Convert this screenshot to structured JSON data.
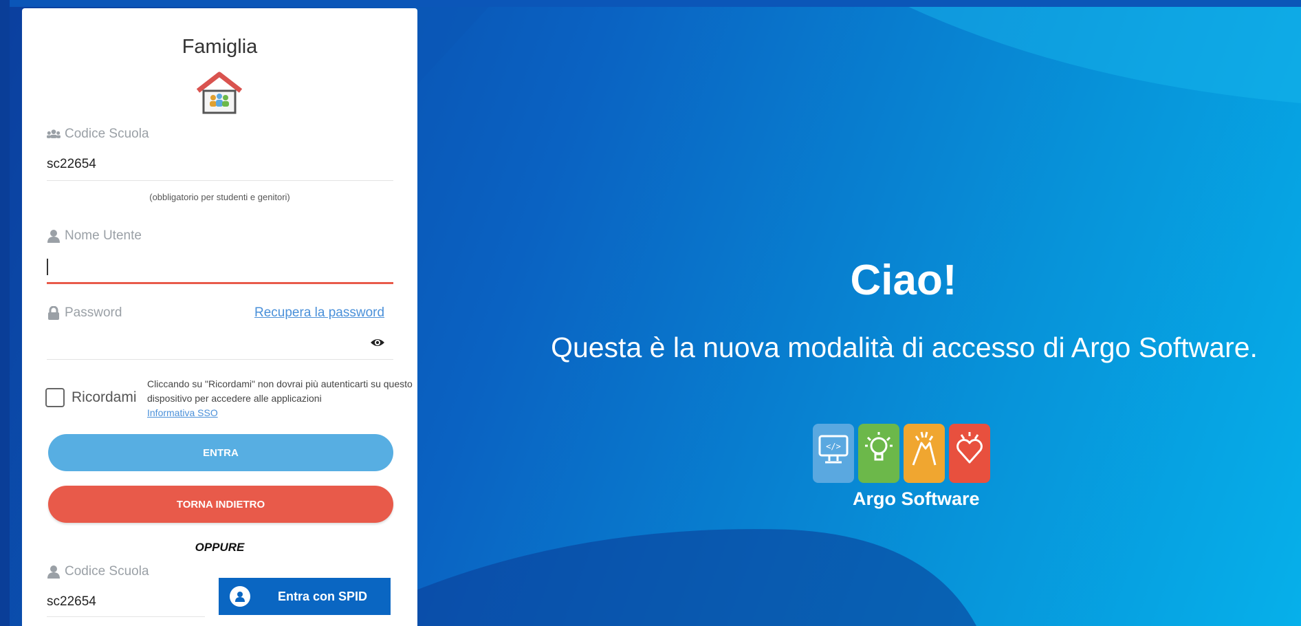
{
  "card": {
    "title": "Famiglia",
    "school_code": {
      "label": "Codice Scuola",
      "value": "sc22654",
      "hint": "(obbligatorio per studenti e genitori)"
    },
    "username": {
      "label": "Nome Utente",
      "value": ""
    },
    "password": {
      "label": "Password",
      "recover_link": "Recupera la password",
      "value": ""
    },
    "remember": {
      "label": "Ricordami",
      "note": "Cliccando su \"Ricordami\" non dovrai più autenticarti su questo dispositivo per accedere alle applicazioni",
      "sso_link": "Informativa SSO",
      "checked": false
    },
    "enter_button": "ENTRA",
    "back_button": "TORNA INDIETRO",
    "or_text": "OPPURE",
    "spid": {
      "code_label": "Codice Scuola",
      "code_value": "sc22654",
      "button_label": "Entra con SPID"
    }
  },
  "hero": {
    "title": "Ciao!",
    "subtitle": "Questa è la nuova modalità di accesso di Argo Software.",
    "logo_text": "Argo Software"
  },
  "colors": {
    "enter": "#57aee2",
    "back": "#e85a4a",
    "spid": "#0a66c2",
    "logo_tiles": [
      "#5aa8e0",
      "#6cb84a",
      "#f0a630",
      "#e8503e"
    ]
  }
}
